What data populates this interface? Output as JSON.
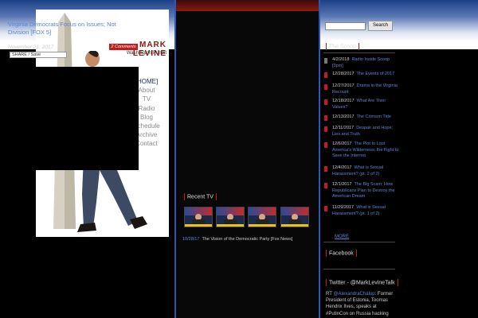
{
  "brand": {
    "name": "MARK LEVINE",
    "subtitle": "Washington Pundit"
  },
  "nav": [
    {
      "label": "[HOME]",
      "active": true
    },
    {
      "label": "About"
    },
    {
      "label": "TV"
    },
    {
      "label": "Radio"
    },
    {
      "label": "Blog"
    },
    {
      "label": "Schedule"
    },
    {
      "label": "Archive"
    },
    {
      "label": "Contact"
    }
  ],
  "post": {
    "title": "Virginia Democrats Focus on Issues; Not Division [FOX 5]",
    "date": "November 21, 2017",
    "comments": "2 Comments",
    "share": "SHARE / Save"
  },
  "recent_tv": {
    "heading": "Recent TV",
    "date": "10/28/17",
    "title": "The Vision of the Democratic Party [Fox News]"
  },
  "search": {
    "button": "Search"
  },
  "scoop": {
    "heading": "The Scoop",
    "items": [
      {
        "date": "4/2/2018",
        "title": "Radio Inside Scoop [3pm]"
      },
      {
        "date": "12/28/2017",
        "title": "The Events of 2017"
      },
      {
        "date": "12/27/2017",
        "title": "Drama in the Virginia Recount"
      },
      {
        "date": "12/18/2017",
        "title": "What Are Their Values?"
      },
      {
        "date": "12/13/2017",
        "title": "The Crimson Tide"
      },
      {
        "date": "12/11/2017",
        "title": "Despair and Hope; Lies and Truth"
      },
      {
        "date": "12/6/2017",
        "title": "The Plot to Loot America's Wilderness; the Fight to Save the Internet"
      },
      {
        "date": "12/4/2017",
        "title": "What is Sexual Harassment? (pt. 2 of 2)"
      },
      {
        "date": "12/1/2017",
        "title": "The Big Scam: How Republicans Plan to Destroy the American Dream"
      },
      {
        "date": "11/29/2017",
        "title": "What is Sexual Harassment? (pt. 1 of 2)"
      }
    ],
    "more": "MORE"
  },
  "facebook": {
    "heading": "Facebook"
  },
  "twitter": {
    "heading": "Twitter - @MarkLevineTalk",
    "rt": "RT ",
    "handle": "@AlexandraChalup",
    "text": ": Former President of Estonia, Toomas Hendrix Ilves, speaks at #PutinCon on Russia hacking"
  },
  "colors": {
    "accent": "#c41a1a",
    "link": "#5b86d6",
    "frame": "#2f56b0"
  }
}
